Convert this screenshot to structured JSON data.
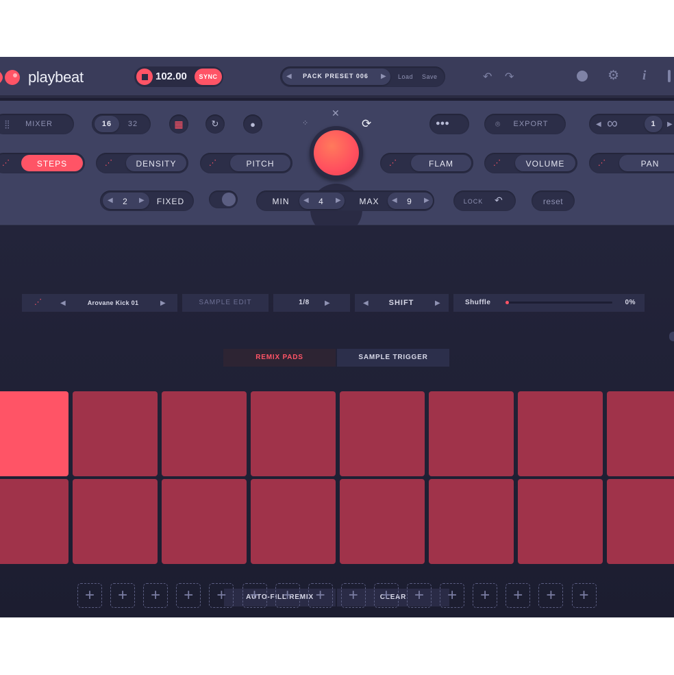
{
  "app": {
    "name": "playbeat"
  },
  "transport": {
    "bpm": "102.00",
    "sync_label": "SYNC"
  },
  "preset": {
    "name": "PACK PRESET 006",
    "load": "Load",
    "save": "Save"
  },
  "header_icons": [
    "undo-icon",
    "redo-icon",
    "playbeat-logo-icon",
    "gear-icon",
    "info-icon",
    "more-icon"
  ],
  "toolbar": {
    "mixer": "MIXER",
    "steps_16": "16",
    "steps_32": "32",
    "export": "EXPORT",
    "pattern_num": "1"
  },
  "params": {
    "steps": "STEPS",
    "density": "DENSITY",
    "pitch": "PITCH",
    "flam": "FLAM",
    "volume": "VOLUME",
    "pan": "PAN"
  },
  "range": {
    "fixed_value": "2",
    "fixed_label": "FIXED",
    "min_label": "MIN",
    "min_value": "4",
    "max_label": "MAX",
    "max_value": "9",
    "lock_label": "LOCK",
    "reset_label": "reset"
  },
  "sample_bar": {
    "sample_name": "Arovane Kick 01",
    "sample_edit": "SAMPLE EDIT",
    "division": "1/8",
    "shift": "SHIFT",
    "shuffle_label": "Shuffle",
    "shuffle_value": "0%"
  },
  "mode_tabs": {
    "remix": "REMIX PADS",
    "trigger": "SAMPLE TRIGGER",
    "active": "remix"
  },
  "pads": {
    "rows": 2,
    "cols": 8,
    "active_index": 0
  },
  "actions": {
    "autofill": "AUTO-FILL REMIX",
    "clear": "CLEAR"
  },
  "slots": {
    "count": 16,
    "glyph": "+"
  },
  "colors": {
    "accent": "#ff5466",
    "pad": "#a0334a",
    "panel": "#3f4262",
    "bg": "#1f1f33"
  }
}
